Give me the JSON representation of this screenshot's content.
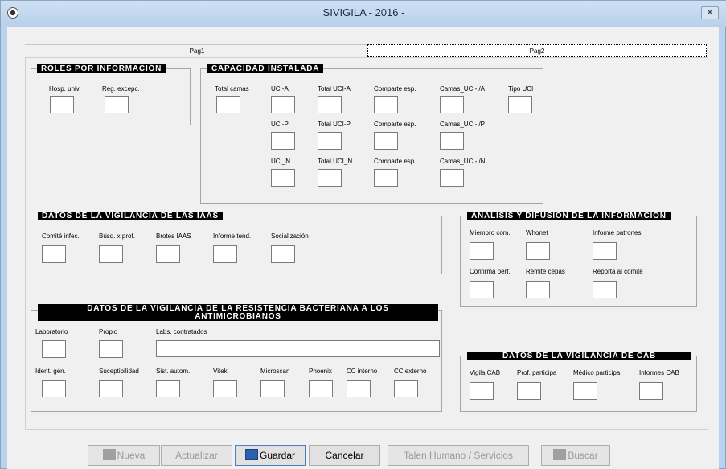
{
  "window": {
    "title": "SIVIGILA - 2016 -"
  },
  "tabs": {
    "pag1": "Pag1",
    "pag2": "Pag2"
  },
  "roles": {
    "title": "ROLES POR INFORMACIÓN",
    "hosp_univ": "Hosp. univ.",
    "reg_excepc": "Reg. excepc."
  },
  "capacidad": {
    "title": "CAPACIDAD INSTALADA",
    "total_camas": "Total camas",
    "uci_a": "UCI-A",
    "total_uci_a": "Total UCI-A",
    "comparte_esp": "Comparte esp.",
    "camas_uci_ia": "Camas_UCI-I/A",
    "tipo_uci": "Tipo UCI",
    "uci_p": "UCI-P",
    "total_uci_p": "Total UCI-P",
    "camas_uci_ip": "Camas_UCI-I/P",
    "uci_n": "UCI_N",
    "total_uci_n": "Total UCI_N",
    "camas_uci_in": "Camas_UCI-I/N"
  },
  "iaas": {
    "title": "DATOS DE LA VIGILANCIA DE LAS IAAS",
    "comite_infec": "Comité infec.",
    "busq_prof": "Búsq. x prof.",
    "brotes_iaas": "Brotes IAAS",
    "informe_tend": "Informe tend.",
    "socializacion": "Socialización"
  },
  "analisis": {
    "title": "ANALISIS Y DIFUSION DE LA INFORMACION",
    "miembro_com": "Miembro com.",
    "whonet": "Whonet",
    "informe_patrones": "Informe patrones",
    "confirma_perf": "Confirma perf.",
    "remite_cepas": "Remite cepas",
    "reporta_comite": "Reporta al comité"
  },
  "resistencia": {
    "title_line1": "DATOS DE LA VIGILANCIA DE LA RESISTENCIA BACTERIANA  A LOS",
    "title_line2": "ANTIMICROBIANOS",
    "laboratorio": "Laboratorio",
    "propio": "Propio",
    "labs_contratados": "Labs. contratados",
    "ident_gen": "Ident. gén.",
    "suceptibilidad": "Suceptibilidad",
    "sist_autom": "Sist. autom.",
    "vitek": "Vitek",
    "microscan": "Microscan",
    "phoenix": "Phoenix",
    "cc_interno": "CC interno",
    "cc_externo": "CC externo"
  },
  "cab": {
    "title": "DATOS DE LA VIGILANCIA DE CAB",
    "vigila_cab": "Vigila CAB",
    "prof_participa": "Prof. participa",
    "medico_participa": "Médico participa",
    "informes_cab": "Informes CAB"
  },
  "buttons": {
    "nueva": "Nueva",
    "actualizar": "Actualizar",
    "guardar": "Guardar",
    "cancelar": "Cancelar",
    "talen": "Talen Humano / Servicios",
    "buscar": "Buscar"
  },
  "colors": {
    "titlebar": "#b9d3ee",
    "group_title_bg": "#000000",
    "group_title_fg": "#ffffff"
  }
}
